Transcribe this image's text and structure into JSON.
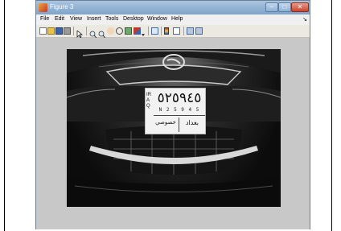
{
  "window": {
    "title": "Figure 3"
  },
  "window_controls": {
    "minimize": "–",
    "maximize": "□",
    "close": "✕"
  },
  "menubar": {
    "items": [
      "File",
      "Edit",
      "View",
      "Insert",
      "Tools",
      "Desktop",
      "Window",
      "Help"
    ],
    "overflow": "↘"
  },
  "toolbar": {
    "icons": [
      "new-figure-icon",
      "open-file-icon",
      "save-icon",
      "print-icon",
      "arrow-select-icon",
      "zoom-in-icon",
      "zoom-out-icon",
      "pan-icon",
      "rotate-3d-icon",
      "data-cursor-icon",
      "brush-icon",
      "link-plot-icon",
      "colorbar-icon",
      "legend-icon",
      "hide-plot-tools-icon",
      "show-plot-tools-icon"
    ]
  },
  "plate": {
    "side_text": "IRAQ",
    "big_number": "٥٢٥٩٤٥",
    "latin_line": "N  2 5 9 4 5",
    "city": "بغداد",
    "category": "خصوصي"
  },
  "colors": {
    "titlebar": "#8fb0d4",
    "figure_background": "#c8c8c8",
    "plate": "#f2f2f2"
  }
}
